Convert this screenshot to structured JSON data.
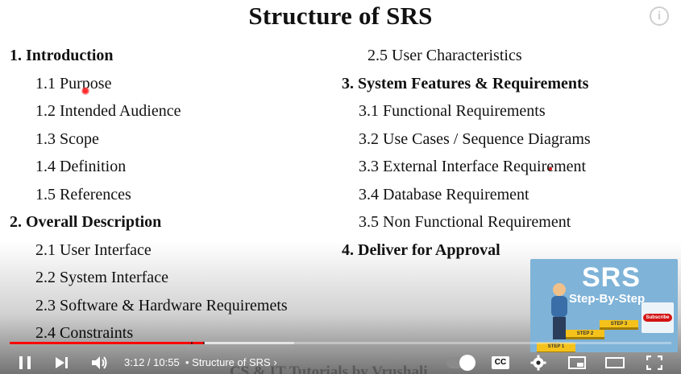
{
  "slide": {
    "title": "Structure of SRS",
    "left_column": [
      {
        "text": "1.   Introduction",
        "bold": true
      },
      {
        "text": "1.1 Purpose"
      },
      {
        "text": "1.2 Intended Audience"
      },
      {
        "text": "1.3 Scope"
      },
      {
        "text": "1.4 Definition"
      },
      {
        "text": "1.5 References"
      },
      {
        "text": "2.   Overall Description",
        "bold": true
      },
      {
        "text": "2.1 User Interface"
      },
      {
        "text": "2.2 System Interface"
      },
      {
        "text": "2.3 Software & Hardware Requiremets"
      },
      {
        "text": "2.4 Constraints"
      }
    ],
    "right_column": [
      {
        "text": "2.5 User Characteristics"
      },
      {
        "text": "3. System Features & Requirements",
        "bold": true
      },
      {
        "text": "3.1 Functional Requirements"
      },
      {
        "text": "3.2 Use Cases / Sequence Diagrams"
      },
      {
        "text": "3.3 External Interface Requirement"
      },
      {
        "text": "3.4 Database Requirement"
      },
      {
        "text": "3.5 Non Functional Requirement"
      },
      {
        "text": "4.  Deliver for Approval",
        "bold": true
      }
    ],
    "watermark": "CS & IT Tutorials by Vrushali"
  },
  "end_card": {
    "title": "SRS",
    "subtitle": "Step-By-Step",
    "steps": [
      "STEP 1",
      "STEP 2",
      "STEP 3"
    ],
    "subscribe_label": "Subscribe"
  },
  "player": {
    "current_time": "3:12",
    "duration": "10:55",
    "time_text": "3:12 / 10:55",
    "chapter_text": "• Structure of SRS",
    "played_fraction": 0.293,
    "buffered_fraction": 0.43,
    "cc_label": "CC",
    "colors": {
      "played": "#ff0000",
      "controls": "#ffffff"
    },
    "icons": [
      "pause-icon",
      "next-icon",
      "volume-icon",
      "chevron-right-icon",
      "autoplay-toggle-icon",
      "captions-icon",
      "settings-icon",
      "miniplayer-icon",
      "theater-icon",
      "fullscreen-icon",
      "info-icon"
    ]
  }
}
